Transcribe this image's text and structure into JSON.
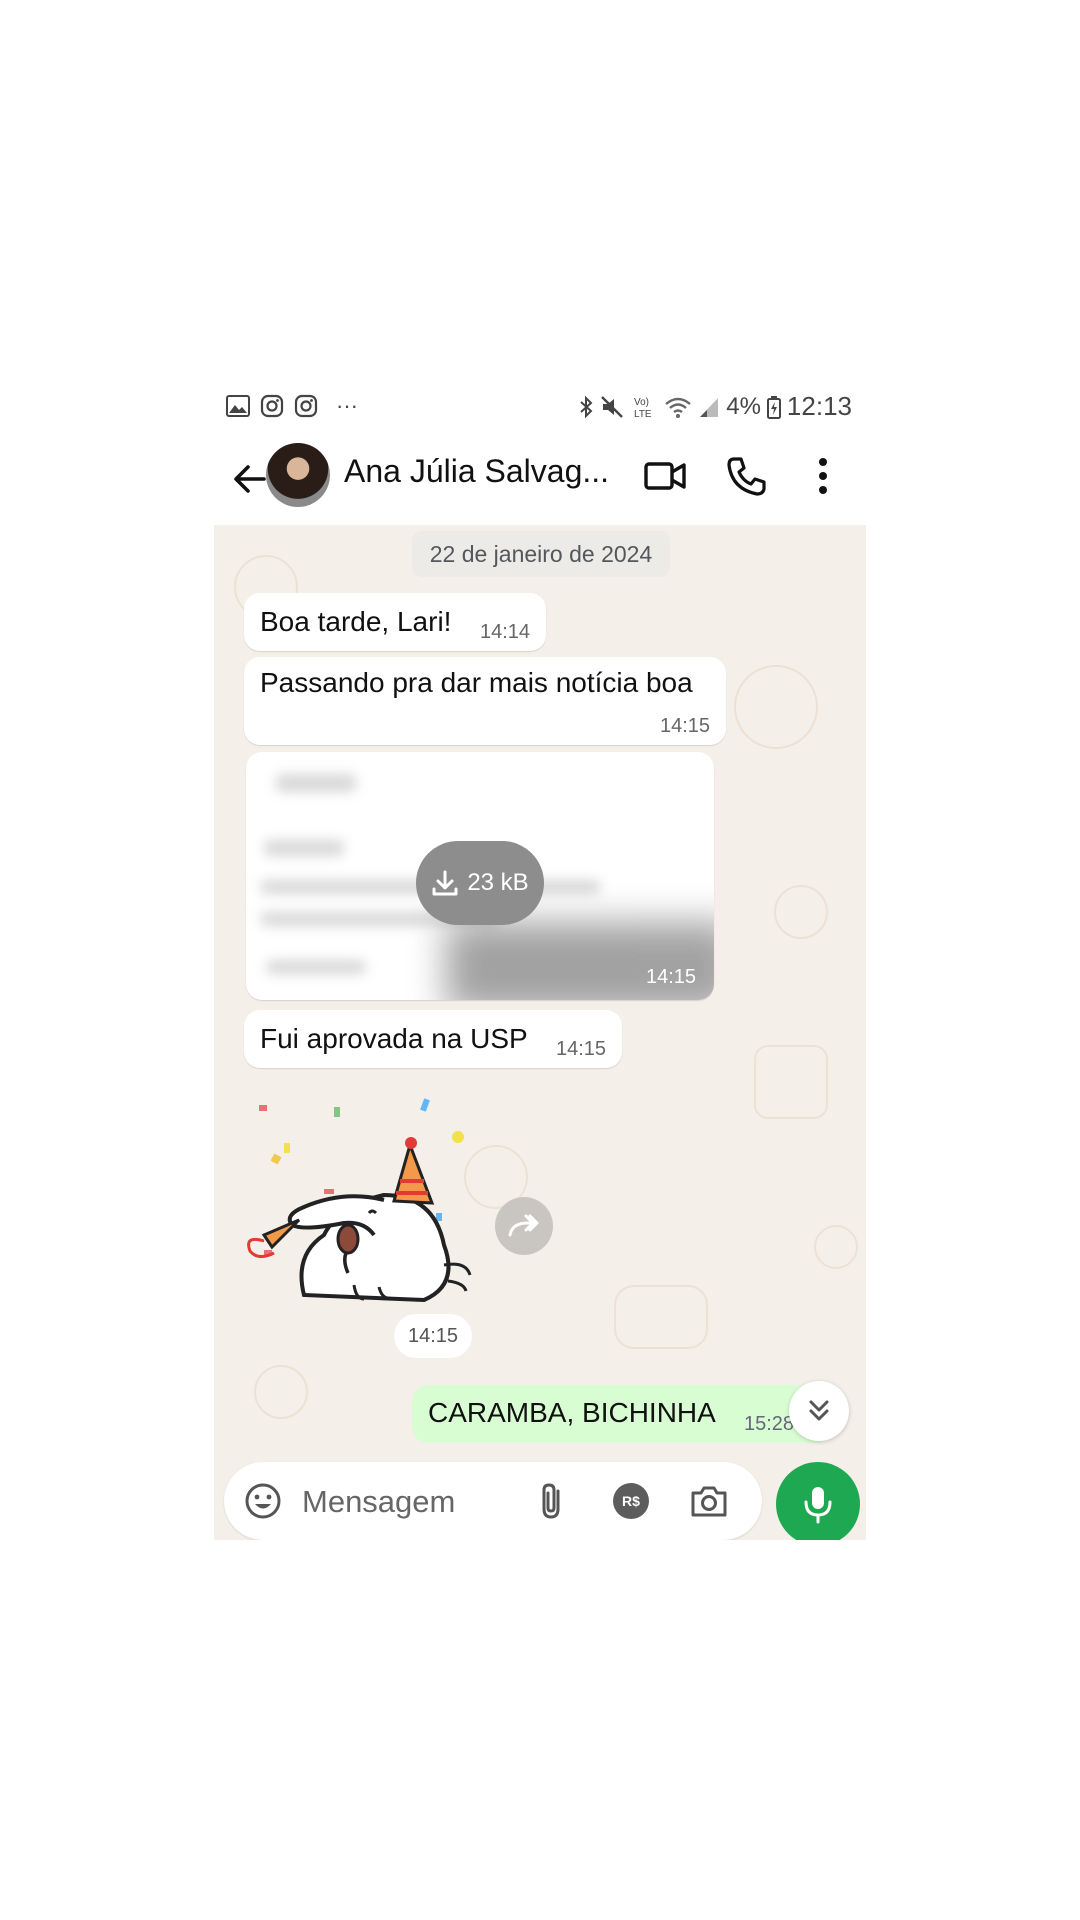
{
  "status_bar": {
    "battery": "4%",
    "time": "12:13",
    "more": "···"
  },
  "header": {
    "contact_name": "Ana Júlia Salvag..."
  },
  "chat": {
    "date": "22 de janeiro de 2024",
    "messages": [
      {
        "text": "Boa tarde, Lari!",
        "time": "14:14"
      },
      {
        "text": "Passando pra dar mais notícia boa",
        "time": "14:15"
      },
      {
        "download_size": "23 kB",
        "time": "14:15"
      },
      {
        "text": "Fui aprovada na USP",
        "time": "14:15"
      },
      {
        "sticker": "party-anteater-sticker",
        "time": "14:15"
      },
      {
        "text": "CARAMBA, BICHINHA",
        "time": "15:28",
        "outgoing": true
      }
    ]
  },
  "input": {
    "placeholder": "Mensagem",
    "currency_label": "R$"
  },
  "colors": {
    "accent_green": "#1da851",
    "outgoing_bubble": "#d9fdd3",
    "chat_bg": "#f4efe8"
  },
  "icons": [
    "gallery-icon",
    "instagram-icon",
    "bluetooth-icon",
    "mute-icon",
    "volte-icon",
    "wifi-icon",
    "signal-icon",
    "battery-icon",
    "back-arrow-icon",
    "video-call-icon",
    "phone-icon",
    "more-vert-icon",
    "download-icon",
    "forward-icon",
    "double-chevron-down-icon",
    "emoji-icon",
    "attach-icon",
    "pix-icon",
    "camera-icon",
    "mic-icon"
  ]
}
